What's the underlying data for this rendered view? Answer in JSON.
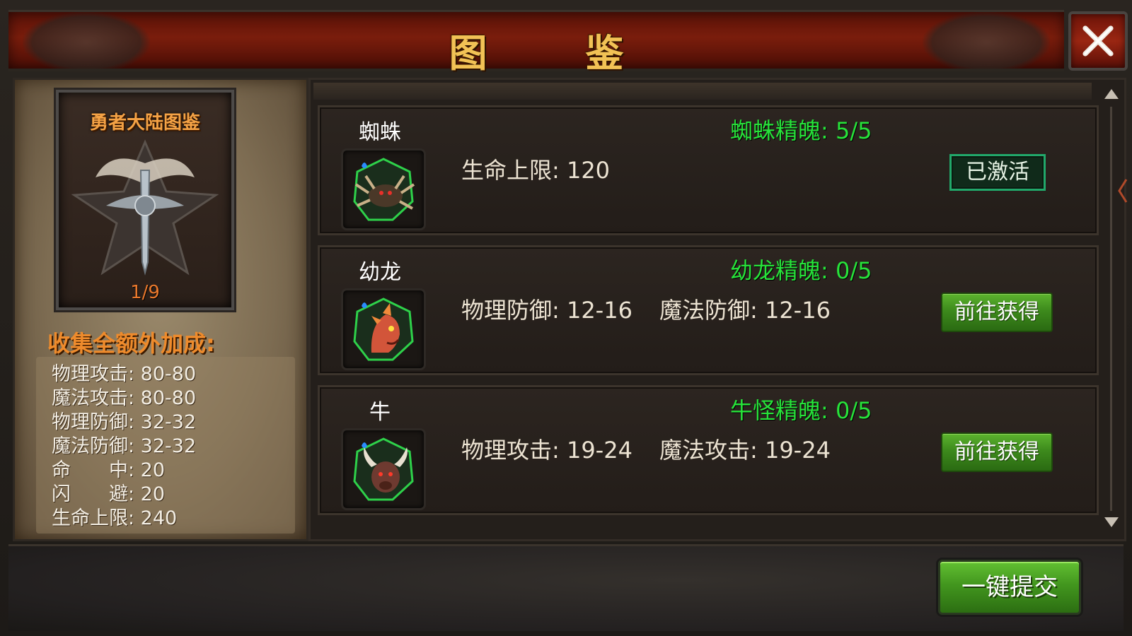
{
  "header": {
    "title": "图 鉴"
  },
  "close_icon": "close-x-icon",
  "collection": {
    "card_title": "勇者大陆图鉴",
    "progress": "1/9",
    "bonus_title": "收集全额外加成:",
    "bonuses": [
      "物理攻击: 80-80",
      "魔法攻击: 80-80",
      "物理防御: 32-32",
      "魔法防御: 32-32",
      "命　　中: 20",
      "闪　　避: 20",
      "生命上限: 240"
    ]
  },
  "entries": [
    {
      "name": "蜘蛛",
      "icon": "spider-icon",
      "soul": "蜘蛛精魄: 5/5",
      "stats": [
        "生命上限: 120"
      ],
      "button": "已激活",
      "activated": true
    },
    {
      "name": "幼龙",
      "icon": "young-dragon-icon",
      "soul": "幼龙精魄: 0/5",
      "stats": [
        "物理防御: 12-16",
        "魔法防御: 12-16"
      ],
      "button": "前往获得",
      "activated": false
    },
    {
      "name": "牛",
      "icon": "bull-monster-icon",
      "soul": "牛怪精魄: 0/5",
      "stats": [
        "物理攻击: 19-24",
        "魔法攻击: 19-24"
      ],
      "button": "前往获得",
      "activated": false
    }
  ],
  "footer": {
    "submit_label": "一键提交"
  },
  "colors": {
    "title": "#f2c255",
    "soul_text": "#27e33a",
    "bonus_title": "#ee8b2c",
    "button_green": "#42961e"
  }
}
